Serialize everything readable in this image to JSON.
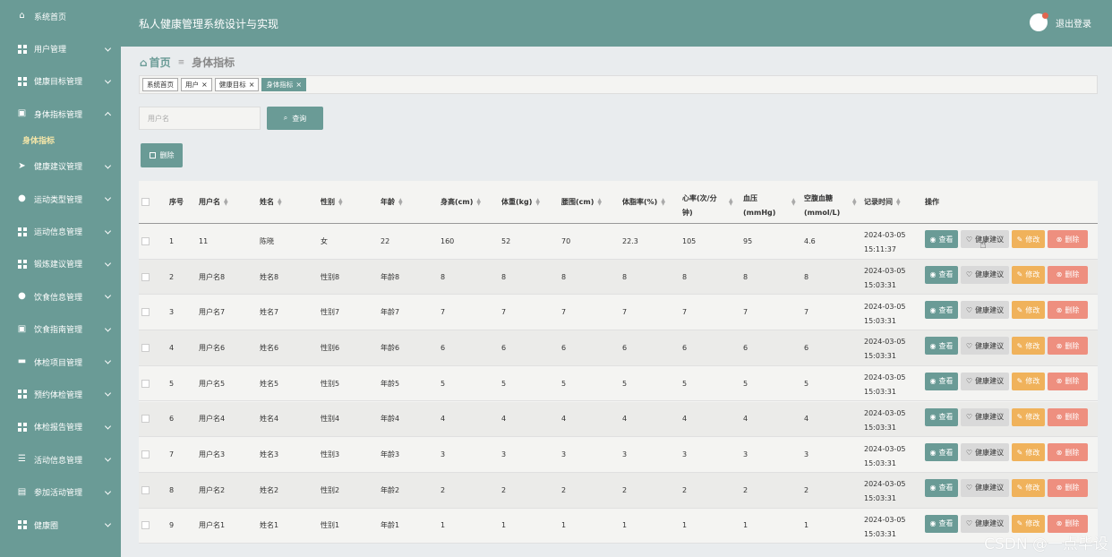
{
  "header": {
    "title": "私人健康管理系统设计与实现",
    "logout_label": "退出登录"
  },
  "sidebar": {
    "home": "系统首页",
    "items": [
      {
        "label": "用户管理",
        "icon": "grid-icon"
      },
      {
        "label": "健康目标管理",
        "icon": "grid-icon"
      },
      {
        "label": "身体指标管理",
        "icon": "clipboard-icon",
        "expanded": true,
        "sub": "身体指标"
      },
      {
        "label": "健康建议管理",
        "icon": "send-icon"
      },
      {
        "label": "运动类型管理",
        "icon": "user-icon"
      },
      {
        "label": "运动信息管理",
        "icon": "grid-icon"
      },
      {
        "label": "锻炼建议管理",
        "icon": "grid-icon"
      },
      {
        "label": "饮食信息管理",
        "icon": "location-icon"
      },
      {
        "label": "饮食指南管理",
        "icon": "clipboard-icon"
      },
      {
        "label": "体检项目管理",
        "icon": "chat-icon"
      },
      {
        "label": "预约体检管理",
        "icon": "grid-icon"
      },
      {
        "label": "体检报告管理",
        "icon": "grid-icon"
      },
      {
        "label": "活动信息管理",
        "icon": "list-icon"
      },
      {
        "label": "参加活动管理",
        "icon": "bag-icon"
      },
      {
        "label": "健康圈",
        "icon": "grid-icon"
      }
    ]
  },
  "breadcrumb": {
    "home": "首页",
    "sep": "≡",
    "current": "身体指标"
  },
  "tags": [
    {
      "label": "系统首页",
      "closable": false,
      "active": false
    },
    {
      "label": "用户",
      "closable": true,
      "active": false
    },
    {
      "label": "健康目标",
      "closable": true,
      "active": false
    },
    {
      "label": "身体指标",
      "closable": true,
      "active": true
    }
  ],
  "search": {
    "placeholder": "用户名",
    "button_label": "查询"
  },
  "toolbar": {
    "delete_label": "删除"
  },
  "table": {
    "columns": {
      "no": "序号",
      "username": "用户名",
      "name": "姓名",
      "gender": "性别",
      "age": "年龄",
      "height": "身高(cm)",
      "weight": "体重(kg)",
      "waist": "腰围(cm)",
      "bodyfat": "体脂率(%)",
      "heartrate": "心率(次/分钟)",
      "bloodpressure": "血压(mmHg)",
      "glucose": "空腹血糖(mmol/L)",
      "time": "记录时间",
      "actions": "操作"
    },
    "actions": {
      "view": "查看",
      "advice": "健康建议",
      "edit": "修改",
      "delete": "删除"
    },
    "rows": [
      {
        "no": "1",
        "username": "11",
        "name": "陈晓",
        "gender": "女",
        "age": "22",
        "height": "160",
        "weight": "52",
        "waist": "70",
        "bodyfat": "22.3",
        "heartrate": "105",
        "bloodpressure": "95",
        "glucose": "4.6",
        "time": "2024-03-05 15:11:37"
      },
      {
        "no": "2",
        "username": "用户名8",
        "name": "姓名8",
        "gender": "性别8",
        "age": "年龄8",
        "height": "8",
        "weight": "8",
        "waist": "8",
        "bodyfat": "8",
        "heartrate": "8",
        "bloodpressure": "8",
        "glucose": "8",
        "time": "2024-03-05 15:03:31"
      },
      {
        "no": "3",
        "username": "用户名7",
        "name": "姓名7",
        "gender": "性别7",
        "age": "年龄7",
        "height": "7",
        "weight": "7",
        "waist": "7",
        "bodyfat": "7",
        "heartrate": "7",
        "bloodpressure": "7",
        "glucose": "7",
        "time": "2024-03-05 15:03:31"
      },
      {
        "no": "4",
        "username": "用户名6",
        "name": "姓名6",
        "gender": "性别6",
        "age": "年龄6",
        "height": "6",
        "weight": "6",
        "waist": "6",
        "bodyfat": "6",
        "heartrate": "6",
        "bloodpressure": "6",
        "glucose": "6",
        "time": "2024-03-05 15:03:31"
      },
      {
        "no": "5",
        "username": "用户名5",
        "name": "姓名5",
        "gender": "性别5",
        "age": "年龄5",
        "height": "5",
        "weight": "5",
        "waist": "5",
        "bodyfat": "5",
        "heartrate": "5",
        "bloodpressure": "5",
        "glucose": "5",
        "time": "2024-03-05 15:03:31"
      },
      {
        "no": "6",
        "username": "用户名4",
        "name": "姓名4",
        "gender": "性别4",
        "age": "年龄4",
        "height": "4",
        "weight": "4",
        "waist": "4",
        "bodyfat": "4",
        "heartrate": "4",
        "bloodpressure": "4",
        "glucose": "4",
        "time": "2024-03-05 15:03:31"
      },
      {
        "no": "7",
        "username": "用户名3",
        "name": "姓名3",
        "gender": "性别3",
        "age": "年龄3",
        "height": "3",
        "weight": "3",
        "waist": "3",
        "bodyfat": "3",
        "heartrate": "3",
        "bloodpressure": "3",
        "glucose": "3",
        "time": "2024-03-05 15:03:31"
      },
      {
        "no": "8",
        "username": "用户名2",
        "name": "姓名2",
        "gender": "性别2",
        "age": "年龄2",
        "height": "2",
        "weight": "2",
        "waist": "2",
        "bodyfat": "2",
        "heartrate": "2",
        "bloodpressure": "2",
        "glucose": "2",
        "time": "2024-03-05 15:03:31"
      },
      {
        "no": "9",
        "username": "用户名1",
        "name": "姓名1",
        "gender": "性别1",
        "age": "年龄1",
        "height": "1",
        "weight": "1",
        "waist": "1",
        "bodyfat": "1",
        "heartrate": "1",
        "bloodpressure": "1",
        "glucose": "1",
        "time": "2024-03-05 15:03:31"
      }
    ]
  },
  "watermark": "CSDN @一点毕设",
  "colors": {
    "primary": "#6a9b96",
    "edit": "#f0b25b",
    "delete": "#ee8f7f",
    "advice": "#d9d9d9"
  }
}
